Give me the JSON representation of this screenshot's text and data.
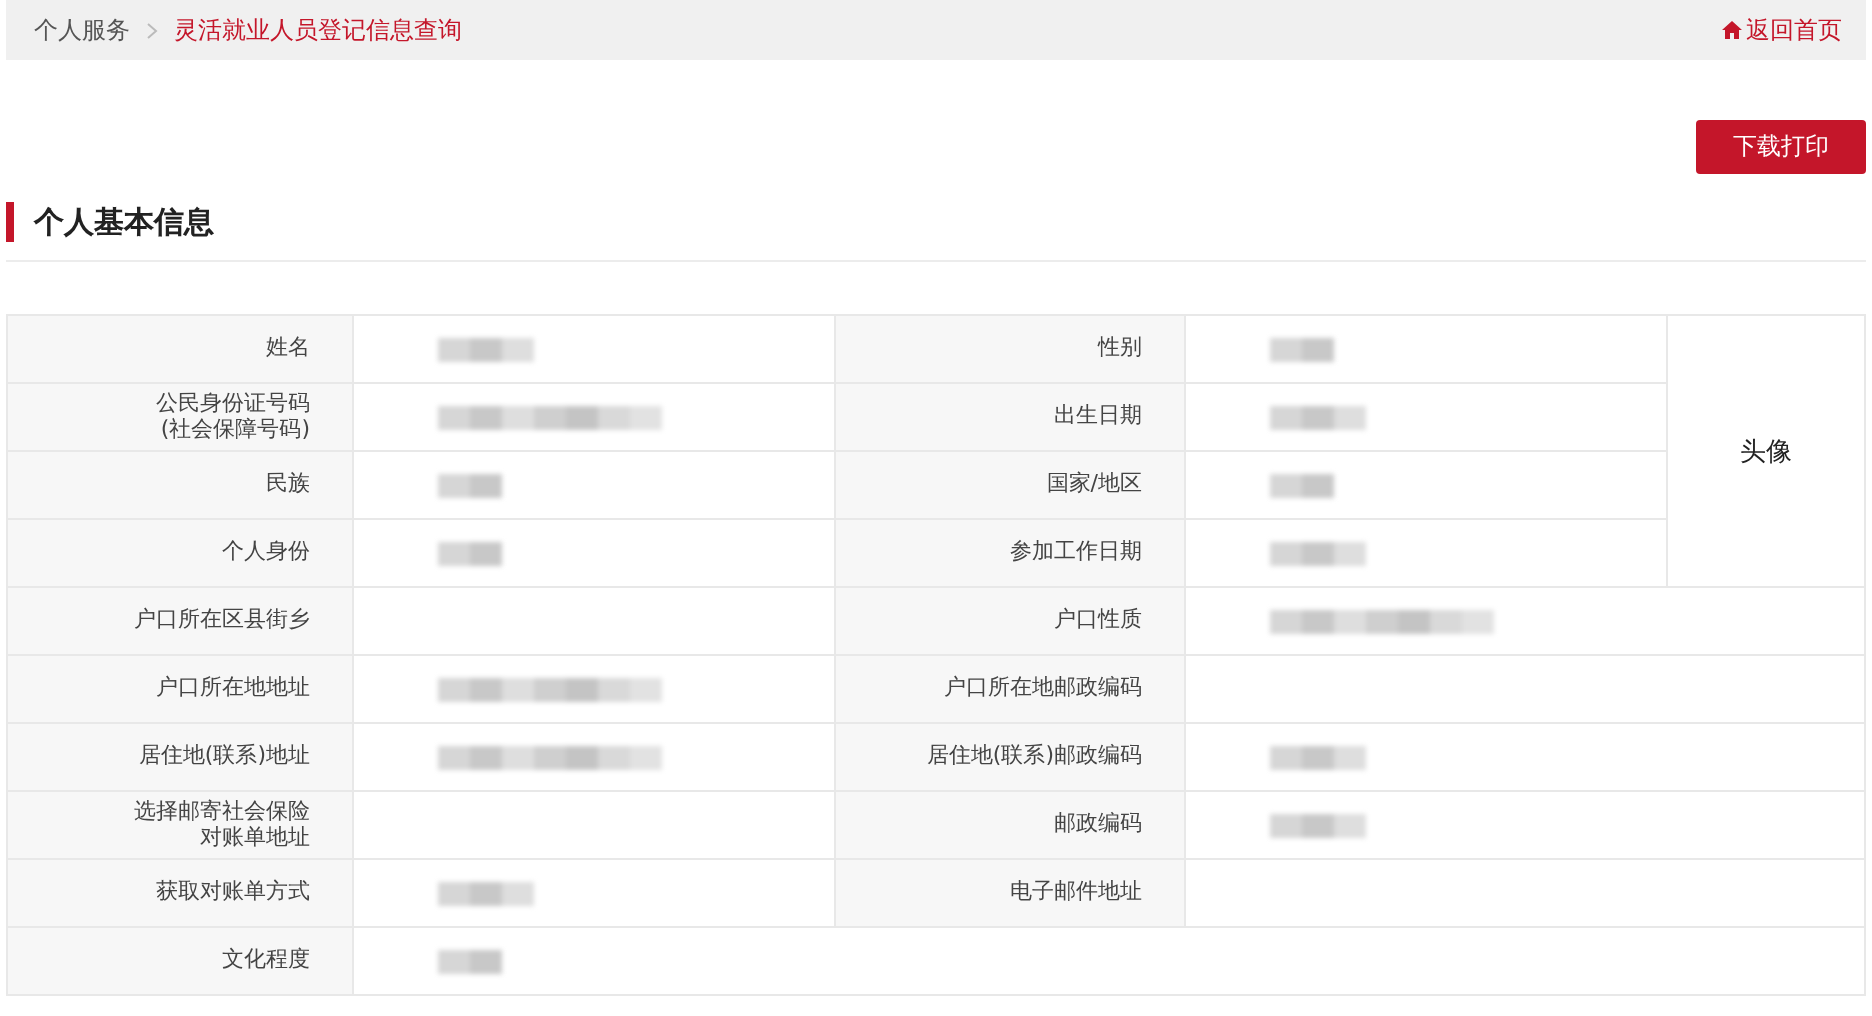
{
  "breadcrumb": {
    "items": [
      {
        "label": "个人服务",
        "current": false
      },
      {
        "label": "灵活就业人员登记信息查询",
        "current": true
      }
    ],
    "home_link": "返回首页"
  },
  "download_button": "下载打印",
  "section_title": "个人基本信息",
  "photo": {
    "label": "头像"
  },
  "rows": [
    {
      "fields": [
        {
          "label_lines": [
            "姓名"
          ],
          "kind": "medium"
        },
        {
          "label_lines": [
            "性别"
          ],
          "kind": "short"
        }
      ]
    },
    {
      "fields": [
        {
          "label_lines": [
            "公民身份证号码",
            "(社会保障号码)"
          ],
          "kind": "long"
        },
        {
          "label_lines": [
            "出生日期"
          ],
          "kind": "medium"
        }
      ]
    },
    {
      "fields": [
        {
          "label_lines": [
            "民族"
          ],
          "kind": "short"
        },
        {
          "label_lines": [
            "国家/地区"
          ],
          "kind": "short"
        }
      ]
    },
    {
      "fields": [
        {
          "label_lines": [
            "个人身份"
          ],
          "kind": "short"
        },
        {
          "label_lines": [
            "参加工作日期"
          ],
          "kind": "medium"
        }
      ]
    },
    {
      "fields": [
        {
          "label_lines": [
            "户口所在区县街乡"
          ],
          "kind": "empty"
        },
        {
          "label_lines": [
            "户口性质"
          ],
          "kind": "long"
        }
      ]
    },
    {
      "fields": [
        {
          "label_lines": [
            "户口所在地地址"
          ],
          "kind": "long"
        },
        {
          "label_lines": [
            "户口所在地邮政编码"
          ],
          "kind": "empty"
        }
      ]
    },
    {
      "fields": [
        {
          "label_lines": [
            "居住地(联系)地址"
          ],
          "kind": "long"
        },
        {
          "label_lines": [
            "居住地(联系)邮政编码"
          ],
          "kind": "medium"
        }
      ]
    },
    {
      "fields": [
        {
          "label_lines": [
            "选择邮寄社会保险",
            "对账单地址"
          ],
          "kind": "empty"
        },
        {
          "label_lines": [
            "邮政编码"
          ],
          "kind": "medium"
        }
      ]
    },
    {
      "fields": [
        {
          "label_lines": [
            "获取对账单方式"
          ],
          "kind": "medium"
        },
        {
          "label_lines": [
            "电子邮件地址"
          ],
          "kind": "empty"
        }
      ]
    },
    {
      "fields": [
        {
          "label_lines": [
            "文化程度"
          ],
          "kind": "short"
        }
      ]
    }
  ]
}
